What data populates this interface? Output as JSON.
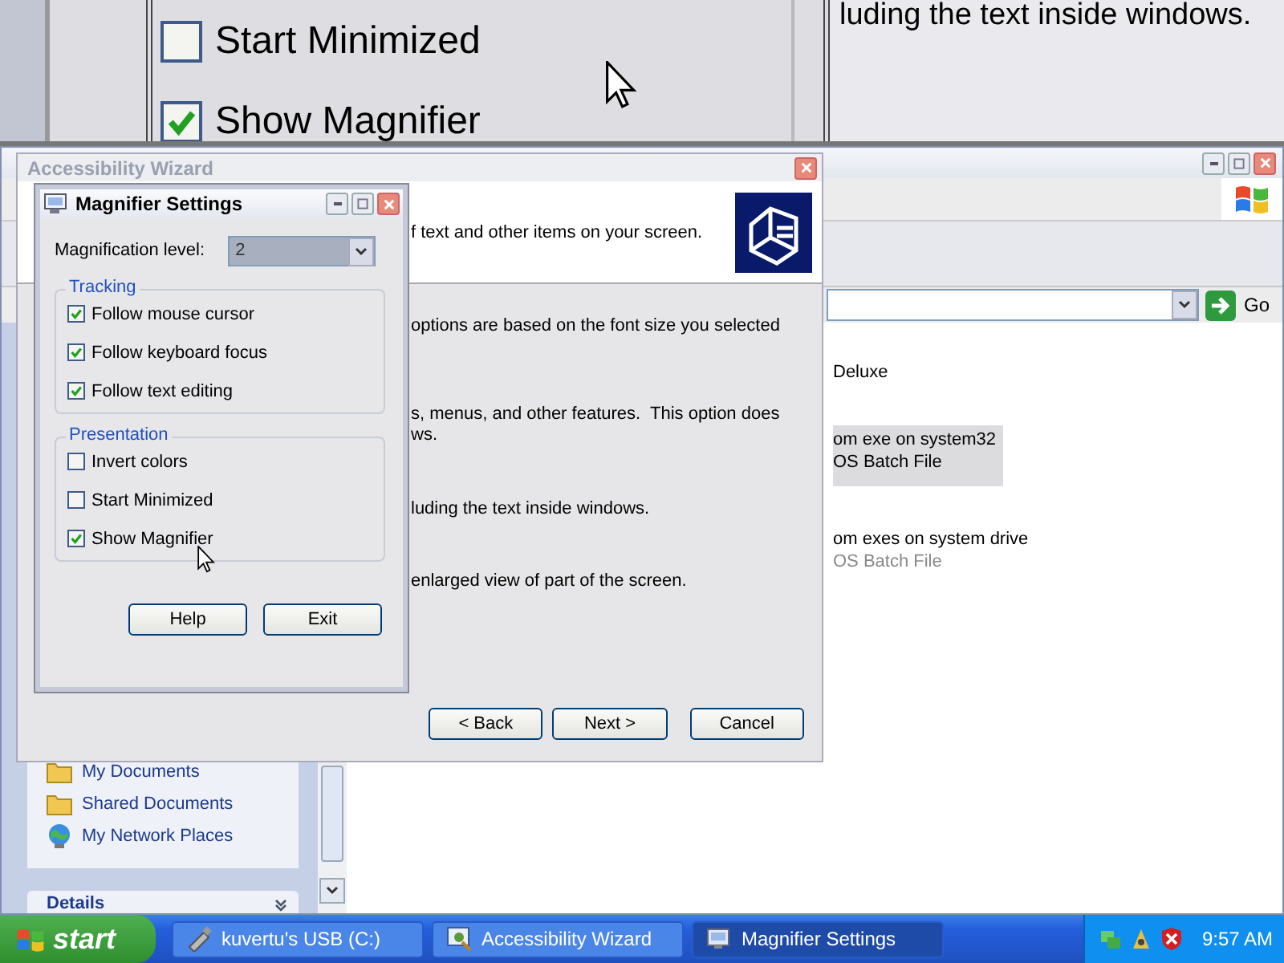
{
  "magnifier_view": {
    "checkboxes": [
      {
        "label": "Start Minimized",
        "checked": false
      },
      {
        "label": "Show Magnifier",
        "checked": true
      }
    ],
    "text": "luding the text inside windows."
  },
  "explorer": {
    "go_button": "Go",
    "items": [
      {
        "name": "Deluxe",
        "selected": false
      },
      {
        "name": "om exe on system32",
        "type": "OS Batch File",
        "selected": true
      },
      {
        "name": "om exes on system drive",
        "type": "OS Batch File",
        "selected": false
      }
    ],
    "places": [
      {
        "label": "My Documents",
        "kind": "folder"
      },
      {
        "label": "Shared Documents",
        "kind": "folder"
      },
      {
        "label": "My Network Places",
        "kind": "network"
      }
    ],
    "details_header": "Details"
  },
  "wizard": {
    "title": "Accessibility Wizard",
    "header_text": "f text and other items on your screen.",
    "body_texts": [
      "options are based on the font size you selected",
      "s, menus, and other features.  This option does\nws.",
      "luding the text inside windows.",
      "enlarged view of part of the screen."
    ],
    "buttons": [
      "< Back",
      "Next >",
      "Cancel"
    ]
  },
  "magnifier_settings": {
    "title": "Magnifier Settings",
    "magnification_level": {
      "label": "Magnification level:",
      "value": "2"
    },
    "groups": [
      {
        "title": "Tracking",
        "options": [
          {
            "label": "Follow mouse cursor",
            "checked": true
          },
          {
            "label": "Follow keyboard focus",
            "checked": true
          },
          {
            "label": "Follow text editing",
            "checked": true
          }
        ]
      },
      {
        "title": "Presentation",
        "options": [
          {
            "label": "Invert colors",
            "checked": false
          },
          {
            "label": "Start Minimized",
            "checked": false
          },
          {
            "label": "Show Magnifier",
            "checked": true
          }
        ]
      }
    ],
    "buttons": [
      "Help",
      "Exit"
    ]
  },
  "taskbar": {
    "start": "start",
    "tasks": [
      {
        "label": "kuvertu's USB (C:)",
        "kind": "drive",
        "selected": false
      },
      {
        "label": "Accessibility Wizard",
        "kind": "wizard",
        "selected": false
      },
      {
        "label": "Magnifier Settings",
        "kind": "magnifier",
        "selected": true
      }
    ],
    "clock": "9:57 AM"
  }
}
